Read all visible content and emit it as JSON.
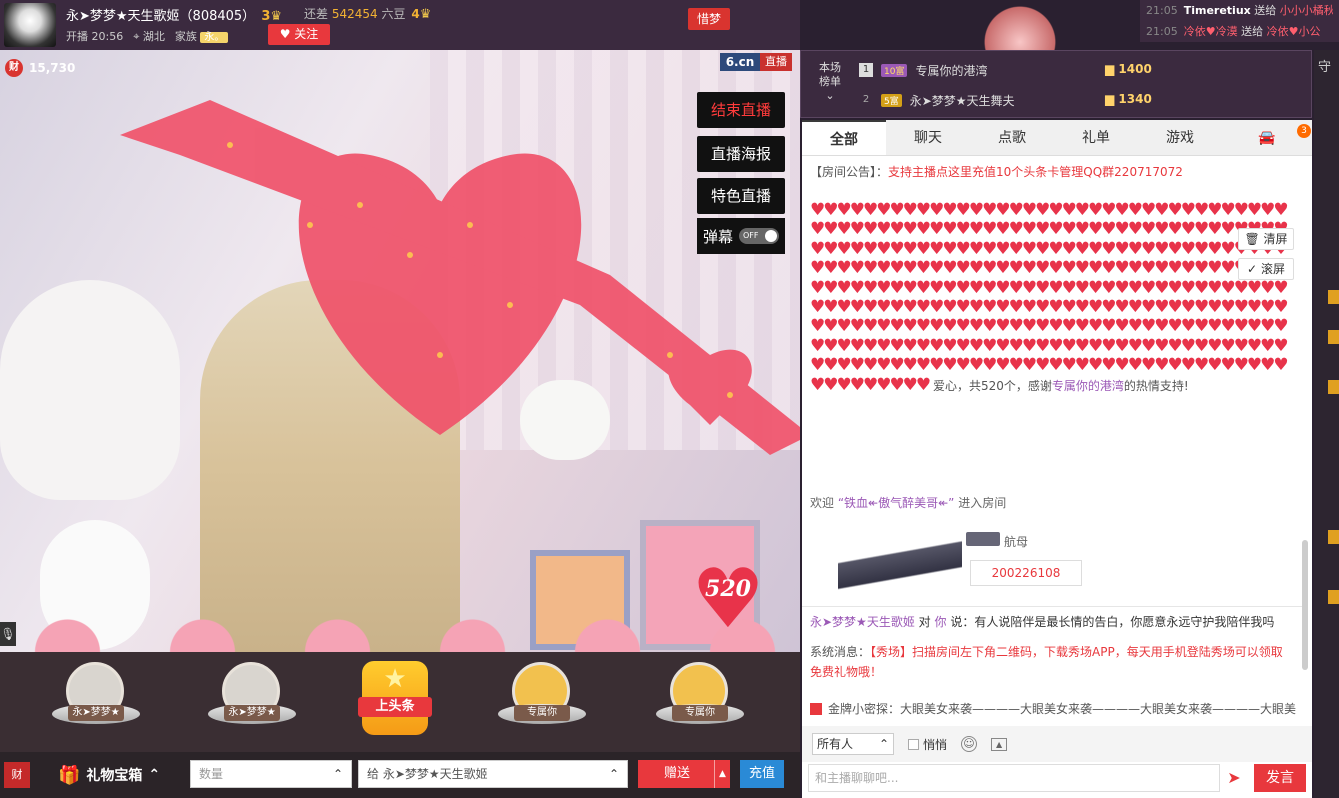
{
  "header": {
    "anchor_name": "永➤梦梦★天生歌姬（808405）",
    "level_a": "3",
    "gap_label": "还差",
    "gap_value": "542454",
    "gap_unit": "六豆",
    "level_b": "4",
    "live_time": "开播 20:56",
    "location": "湖北",
    "family_label": "家族",
    "family_badge": "永。",
    "follow_label": "关注",
    "flag_label": "惜梦"
  },
  "video": {
    "fortune_value": "15,730",
    "fortune_icon_text": "财",
    "brand_logo": "6.cn",
    "brand_tag": "直播",
    "controls": [
      "结束直播",
      "直播海报",
      "特色直播"
    ],
    "danmu_label": "弹幕",
    "danmu_state": "OFF",
    "gift_heart_number": "520"
  },
  "gift_strip": {
    "slots": [
      {
        "tag": "永➤梦梦★"
      },
      {
        "tag": "永➤梦梦★"
      },
      {
        "tag": "上头条"
      },
      {
        "tag": "专属你"
      },
      {
        "tag": "专属你"
      }
    ]
  },
  "bottombar": {
    "fortune_icon_text": "财",
    "giftbox_label": "礼物宝箱",
    "qty_placeholder": "数量",
    "target_prefix": "给",
    "target_name": "永➤梦梦★天生歌姬",
    "send_label": "赠送",
    "recharge_label": "充值"
  },
  "rank": {
    "label": "本场榜单",
    "rows": [
      {
        "num": "1",
        "lvl": "10富",
        "name": "专属你的港湾",
        "score": "1400"
      },
      {
        "num": "2",
        "lvl": "5富",
        "name": "永➤梦梦★天生舞夫",
        "score": "1340"
      }
    ]
  },
  "top_feed": [
    {
      "time": "21:05",
      "user": "Timeretiux",
      "action": "送给",
      "target": "小小小橘秋"
    },
    {
      "time": "21:05",
      "user": "冷依♥冷漠",
      "action": "送给",
      "target": "冷依♥小公"
    }
  ],
  "chat": {
    "tabs": [
      "全部",
      "聊天",
      "点歌",
      "礼单",
      "游戏"
    ],
    "car_badge": "3",
    "notice_label": "【房间公告】：",
    "notice_text": "支持主播点这里充值10个头条卡管理QQ群220717072",
    "clear_label": "清屏",
    "scroll_label": "滚屏",
    "hearts_msg_pre": "爱心，共520个，感谢",
    "hearts_msg_name": "专属你的港湾",
    "hearts_msg_post": "的热情支持!",
    "welcome_pre": "欢迎",
    "welcome_name": "“铁血↞傲气醉美哥↞”",
    "welcome_post": "进入房间",
    "ship_name": "航母",
    "ship_id": "200226108",
    "line_user": "永➤梦梦★天生歌姬",
    "line_to": "对",
    "line_target": "你",
    "line_text": "说：有人说陪伴是最长情的告白，你愿意永远守护我陪伴我吗",
    "sys_label": "系统消息：",
    "sys_text": "【秀场】扫描房间左下角二维码，下载秀场APP，每天用手机登陆秀场可以领取免费礼物哦！",
    "gold_text": "金牌小密探：大眼美女来袭————大眼美女来袭————大眼美女来袭————大眼美",
    "audience": "所有人",
    "whisper": "悄悄",
    "input_placeholder": "和主播聊聊吧...",
    "send_label": "发言"
  },
  "right_strip": {
    "guard_label": "守"
  }
}
